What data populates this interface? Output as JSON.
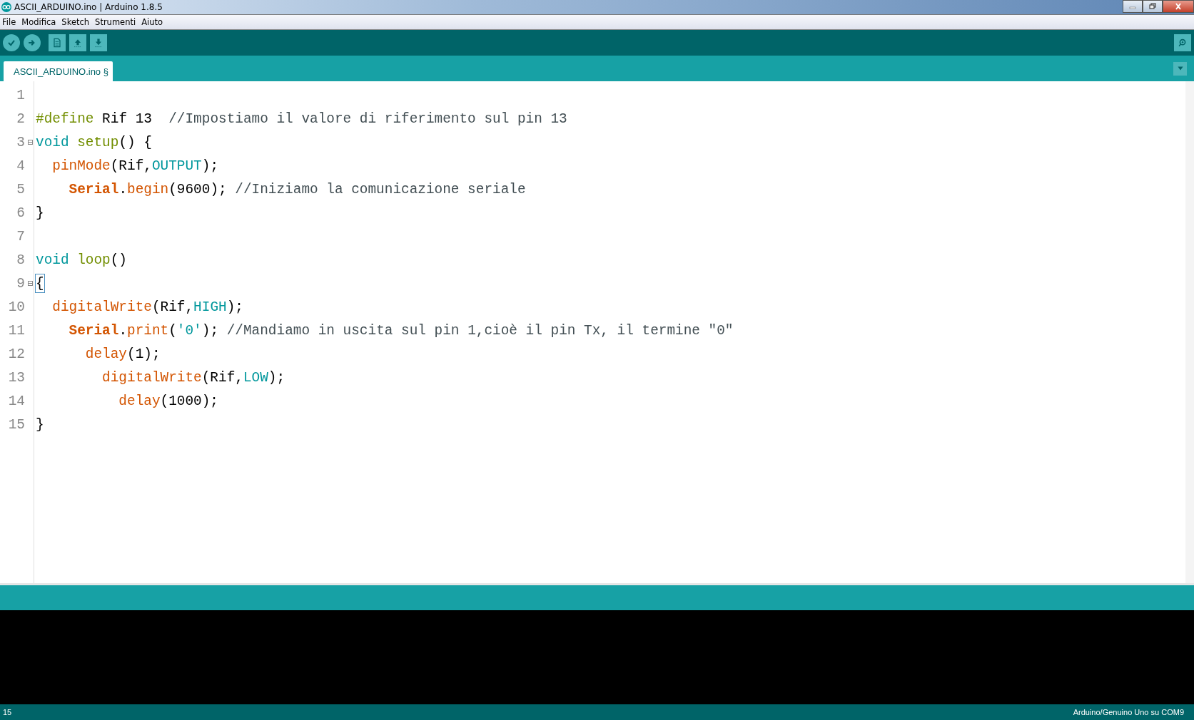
{
  "window": {
    "title": "ASCII_ARDUINO.ino | Arduino 1.8.5"
  },
  "menu": [
    "File",
    "Modifica",
    "Sketch",
    "Strumenti",
    "Aiuto"
  ],
  "tabs": [
    {
      "label": "ASCII_ARDUINO.ino §",
      "selected": true
    }
  ],
  "code": [
    {
      "number": "1",
      "fold": false,
      "bracket": false
    },
    {
      "number": "2",
      "fold": false,
      "bracket": false,
      "tokens": [
        {
          "text": "#define",
          "kind": "directive"
        },
        {
          "text": " Rif 13  ",
          "kind": "plain"
        },
        {
          "text": "//Impostiamo il valore di riferimento sul pin 13",
          "kind": "comment"
        }
      ]
    },
    {
      "number": "3",
      "fold": true,
      "bracket": false,
      "tokens": [
        {
          "text": "void ",
          "kind": "keyword"
        },
        {
          "text": "setup",
          "kind": "directive"
        },
        {
          "text": "() {",
          "kind": "plain"
        }
      ]
    },
    {
      "number": "4",
      "fold": false,
      "bracket": false,
      "tokens": [
        {
          "text": "  pinMode",
          "kind": "function"
        },
        {
          "text": "(Rif,",
          "kind": "plain"
        },
        {
          "text": "OUTPUT",
          "kind": "keyword"
        },
        {
          "text": ");",
          "kind": "plain"
        }
      ]
    },
    {
      "number": "5",
      "fold": false,
      "bracket": false,
      "tokens": [
        {
          "text": "    Serial",
          "kind": "object"
        },
        {
          "text": ".begin",
          "kind": "method"
        },
        {
          "text": "(9600); ",
          "kind": "plain"
        },
        {
          "text": "//Iniziamo la comunicazione seriale",
          "kind": "comment"
        }
      ]
    },
    {
      "number": "6",
      "fold": false,
      "bracket": false,
      "tokens": [
        {
          "text": "}",
          "kind": "plain"
        }
      ]
    },
    {
      "number": "7",
      "fold": false,
      "bracket": false
    },
    {
      "number": "8",
      "fold": false,
      "bracket": false,
      "tokens": [
        {
          "text": "void ",
          "kind": "keyword"
        },
        {
          "text": "loop",
          "kind": "directive"
        },
        {
          "text": "()",
          "kind": "plain"
        }
      ]
    },
    {
      "number": "9",
      "fold": true,
      "bracket": true,
      "tokens": [
        {
          "text": "{",
          "kind": "plain"
        }
      ]
    },
    {
      "number": "10",
      "fold": false,
      "bracket": false,
      "tokens": [
        {
          "text": "  digitalWrite",
          "kind": "function"
        },
        {
          "text": "(Rif,",
          "kind": "plain"
        },
        {
          "text": "HIGH",
          "kind": "keyword"
        },
        {
          "text": ");",
          "kind": "plain"
        }
      ]
    },
    {
      "number": "11",
      "fold": false,
      "bracket": false,
      "tokens": [
        {
          "text": "    Serial",
          "kind": "object"
        },
        {
          "text": ".print",
          "kind": "method"
        },
        {
          "text": "(",
          "kind": "plain"
        },
        {
          "text": "'0'",
          "kind": "keyword"
        },
        {
          "text": "); ",
          "kind": "plain"
        },
        {
          "text": "//Mandiamo in uscita sul pin 1,cioè il pin Tx, il termine \"0\"",
          "kind": "comment"
        }
      ]
    },
    {
      "number": "12",
      "fold": false,
      "bracket": false,
      "tokens": [
        {
          "text": "      delay",
          "kind": "function"
        },
        {
          "text": "(1);",
          "kind": "plain"
        }
      ]
    },
    {
      "number": "13",
      "fold": false,
      "bracket": false,
      "tokens": [
        {
          "text": "        digitalWrite",
          "kind": "function"
        },
        {
          "text": "(Rif,",
          "kind": "plain"
        },
        {
          "text": "LOW",
          "kind": "keyword"
        },
        {
          "text": ");",
          "kind": "plain"
        }
      ]
    },
    {
      "number": "14",
      "fold": false,
      "bracket": false,
      "tokens": [
        {
          "text": "          delay",
          "kind": "function"
        },
        {
          "text": "(1000);",
          "kind": "plain"
        }
      ]
    },
    {
      "number": "15",
      "fold": false,
      "bracket": false,
      "tokens": [
        {
          "text": "}",
          "kind": "plain"
        }
      ]
    }
  ],
  "status_bar": {
    "line": "15",
    "board": "Arduino/Genuino Uno su COM9"
  }
}
